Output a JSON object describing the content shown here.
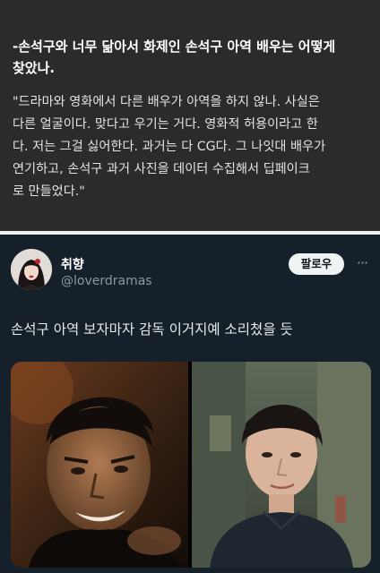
{
  "article": {
    "question_line1": "-손석구와 너무 닮아서 화제인 손석구 아역 배우는 어떻게",
    "question_line2": "찾았나.",
    "quote_lines": [
      "\"드라마와 영화에서 다른 배우가 아역을 하지 않나. 사실은",
      "다른 얼굴이다. 맞다고 우기는 거다. 영화적 허용이라고 한",
      "다. 저는 그걸 싫어한다. 과거는 다 CG다. 그 나잇대 배우가",
      "연기하고, 손석구 과거 사진을 데이터 수집해서 딥페이크",
      "로 만들었다.\""
    ]
  },
  "tweet": {
    "display_name": "취향",
    "handle": "@loverdramas",
    "follow_label": "팔로우",
    "more_label": "···",
    "text": "손석구 아역 보자마자 감독 이거지예 소리쳤을 듯"
  },
  "icons": {
    "more": "more-horizontal-icon"
  },
  "colors": {
    "article_bg": "#2b2b2b",
    "tweet_bg": "#15202b",
    "follow_button_bg": "#eff3f4",
    "handle": "#8b98a5"
  }
}
